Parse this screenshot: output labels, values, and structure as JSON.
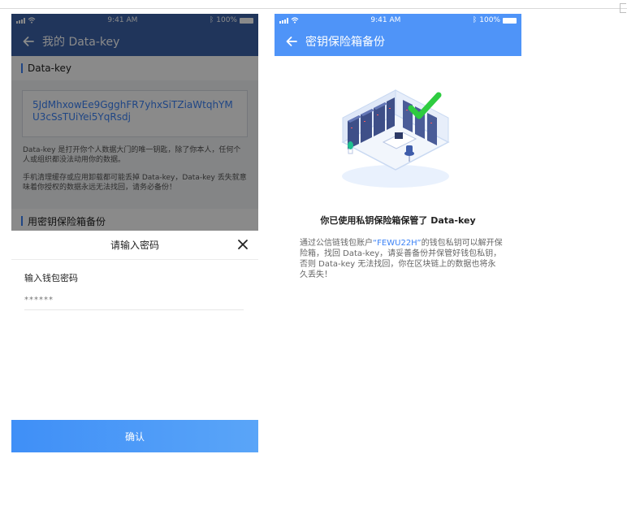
{
  "status_bar": {
    "time": "9:41 AM",
    "battery": "100%"
  },
  "left_screen": {
    "nav_title": "我的 Data-key",
    "section_title": "Data-key",
    "key_value": "5JdMhxowEe9GgghFR7yhxSiTZiaWtqhYMU3cSsTUiYei5YqRsdj",
    "note1": "Data-key 是打开你个人数据大门的唯一钥匙，除了你本人，任何个人或组织都没法动用你的数据。",
    "note2": "手机清理缓存或应用卸载都可能丢掉 Data-key，Data-key 丢失就意味着你授权的数据永远无法找回，请务必备份！",
    "section2_title": "用密钥保险箱备份",
    "dialog": {
      "title": "请输入密码",
      "field_label": "输入钱包密码",
      "field_placeholder": "******",
      "confirm_label": "确认"
    }
  },
  "right_screen": {
    "nav_title": "密钥保险箱备份",
    "headline": "你已使用私钥保险箱保管了 Data-key",
    "desc_prefix": "通过公信链钱包账户",
    "account": "“FEWU22H”",
    "desc_suffix": "的钱包私钥可以解开保险箱，找回 Data-key，请妥善备份并保管好钱包私钥，否则 Data-key 无法找回，你在区块链上的数据也将永久丢失！"
  },
  "colors": {
    "accent": "#3b82f6",
    "nav_left": "#3b63a8",
    "nav_right": "#4f94f8",
    "check": "#2ecc40"
  },
  "icons": [
    "back-arrow-icon",
    "close-icon",
    "signal-icon",
    "wifi-icon",
    "bluetooth-icon",
    "battery-icon",
    "server-room-illustration",
    "checkmark-icon"
  ]
}
